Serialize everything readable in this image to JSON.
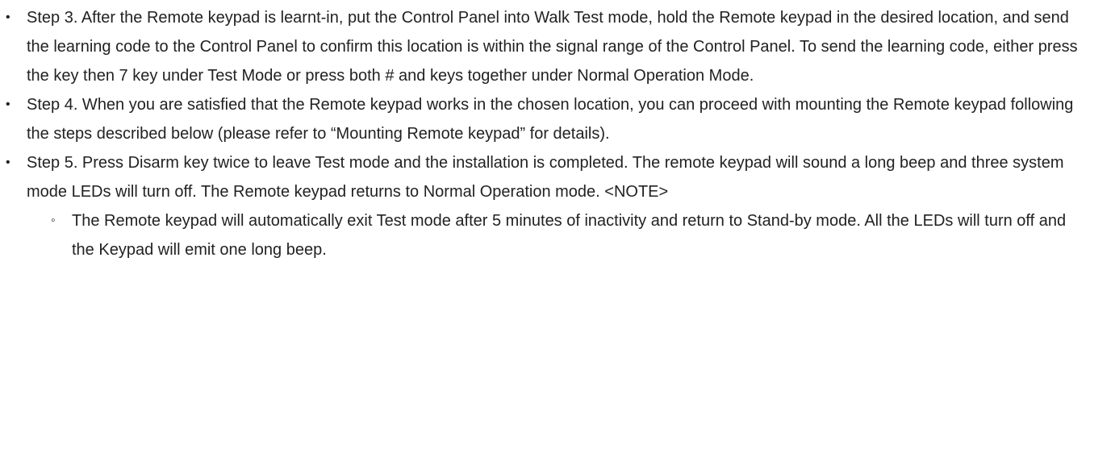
{
  "steps": [
    {
      "text": "Step 3. After the Remote keypad is learnt-in, put the Control Panel into Walk Test mode, hold the Remote keypad in the desired location, and send the learning code to the Control Panel to confirm this location is within the signal range of the Control Panel. To send the learning code, either press the   key then 7 key under Test Mode or press both # and   keys together under Normal Operation Mode."
    },
    {
      "text": "Step 4. When you are satisfied that the Remote keypad works in the chosen location, you can proceed with mounting the Remote keypad following the steps described below (please refer to “Mounting Remote keypad” for details)."
    },
    {
      "text": "Step 5. Press Disarm key twice to leave Test mode and the installation is completed. The remote keypad will sound a long beep and three system mode LEDs will turn off. The Remote keypad returns to Normal Operation mode. <NOTE>",
      "subitems": [
        "The Remote keypad will automatically exit Test mode after 5 minutes of inactivity and return to Stand-by mode. All the LEDs will turn off and the Keypad will emit one long beep."
      ]
    }
  ]
}
